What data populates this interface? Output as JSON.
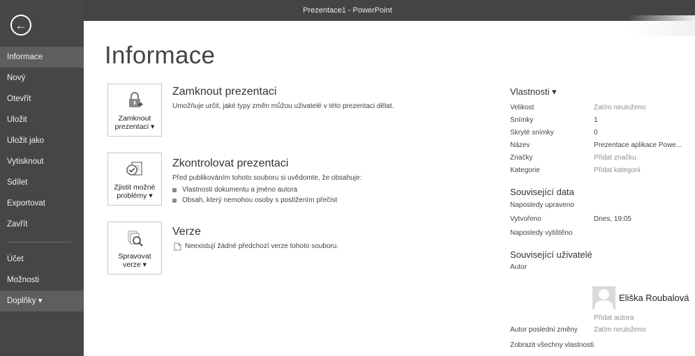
{
  "window": {
    "title": "Prezentace1 - PowerPoint"
  },
  "sidebar": {
    "items": [
      {
        "label": "Informace"
      },
      {
        "label": "Nový"
      },
      {
        "label": "Otevřít"
      },
      {
        "label": "Uložit"
      },
      {
        "label": "Uložit jako"
      },
      {
        "label": "Vytisknout"
      },
      {
        "label": "Sdílet"
      },
      {
        "label": "Exportovat"
      },
      {
        "label": "Zavřít"
      },
      {
        "label": "Účet"
      },
      {
        "label": "Možnosti"
      },
      {
        "label": "Doplňky ▾"
      }
    ]
  },
  "page": {
    "title": "Informace"
  },
  "protect": {
    "button_line1": "Zamknout",
    "button_line2": "prezentaci ▾",
    "heading": "Zamknout prezentaci",
    "description": "Umožňuje určit, jaké typy změn můžou uživatelé v této prezentaci dělat."
  },
  "inspect": {
    "button_line1": "Zjistit možné",
    "button_line2": "problémy ▾",
    "heading": "Zkontrolovat prezentaci",
    "description": "Před publikováním tohoto souboru si uvědomte, že obsahuje:",
    "bullets": [
      "Vlastnosti dokumentu a jméno autora",
      "Obsah, který nemohou osoby s postižením přečíst"
    ]
  },
  "versions": {
    "button_line1": "Spravovat",
    "button_line2": "verze ▾",
    "heading": "Verze",
    "description": "Neexistují žádné předchozí verze tohoto souboru."
  },
  "properties": {
    "header": "Vlastnosti ▾",
    "rows": [
      {
        "key": "Velikost",
        "value": "Zatím neuloženo"
      },
      {
        "key": "Snímky",
        "value": "1"
      },
      {
        "key": "Skryté snímky",
        "value": "0"
      },
      {
        "key": "Název",
        "value": "Prezentace aplikace Powe..."
      },
      {
        "key": "Značky",
        "value": "Přidat značku"
      },
      {
        "key": "Kategorie",
        "value": "Přidat kategorii"
      }
    ]
  },
  "related_dates": {
    "header": "Související data",
    "rows": [
      {
        "key": "Naposledy upraveno",
        "value": ""
      },
      {
        "key": "Vytvořeno",
        "value": "Dnes, 19:05"
      },
      {
        "key": "Naposledy vytištěno",
        "value": ""
      }
    ]
  },
  "related_people": {
    "header": "Související uživatelé",
    "author_label": "Autor",
    "author_name": "Eliška Roubalová",
    "add_author": "Přidat autora",
    "last_modified_label": "Autor poslední změny",
    "last_modified_value": "Zatím neuloženo",
    "show_all": "Zobrazit všechny vlastnosti"
  }
}
